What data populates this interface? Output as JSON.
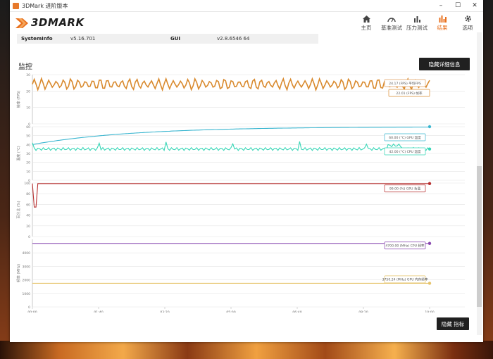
{
  "window": {
    "title": "3DMark 进阶版本",
    "controls": [
      "–",
      "☐",
      "✕"
    ]
  },
  "logo": {
    "text": "3DMARK"
  },
  "nav": [
    {
      "label": "主页",
      "icon": "home-icon"
    },
    {
      "label": "基准测试",
      "icon": "gauge-icon"
    },
    {
      "label": "压力测试",
      "icon": "stress-bars-icon"
    },
    {
      "label": "结果",
      "icon": "results-bars-icon",
      "active": true
    },
    {
      "label": "选项",
      "icon": "gear-icon"
    }
  ],
  "info": {
    "systeminfo_label": "SystemInfo",
    "systeminfo_value": "v5.16.701",
    "gui_label": "GUI",
    "gui_value": "v2.8.6546 64"
  },
  "section": {
    "title": "监控"
  },
  "buttons": {
    "hide_details": "隐藏详细信息",
    "hide_markers": "隐藏 指标"
  },
  "colors": {
    "accent": "#e8701e",
    "frame_rate": "#d98a2e",
    "avg_fps": "#e0a060",
    "cpu_temp": "#36d6b6",
    "gpu_temp": "#3ab6d0",
    "gpu_load": "#b83030",
    "cpu_clock": "#8a4ab0",
    "gpu_mem_clock": "#e6c36a"
  },
  "chart_data": {
    "type": "line",
    "x_ticks": [
      "00:00",
      "01:40",
      "03:20",
      "05:00",
      "06:40",
      "08:20",
      "10:00"
    ],
    "panels": [
      {
        "ylabel": "帧率 (FPS)",
        "ylim": [
          0,
          30
        ],
        "y_ticks": [
          "30",
          "20",
          "10",
          "0"
        ],
        "annotations": [
          {
            "text": "24.17 (FPS) 平均FPS",
            "series": "avg_fps"
          },
          {
            "text": "22.01 (FPS) 帧率",
            "series": "frame_rate"
          }
        ],
        "series": [
          {
            "key": "frame_rate",
            "name": "帧率 (FPS)",
            "mean": 24.17,
            "amplitude": 3.5
          }
        ]
      },
      {
        "ylabel": "温度 (°C)",
        "ylim": [
          0,
          60
        ],
        "y_ticks": [
          "60",
          "50",
          "40",
          "30",
          "20",
          "10",
          "0"
        ],
        "annotations": [
          {
            "text": "60.00 (°C) GPU 温度",
            "series": "gpu_temp"
          },
          {
            "text": "42.00 (°C) CPU 温度",
            "series": "cpu_temp"
          }
        ],
        "series": [
          {
            "key": "gpu_temp",
            "name": "GPU 温度 (°C)",
            "start": 40,
            "end": 60
          },
          {
            "key": "cpu_temp",
            "name": "CPU 温度 (°C)",
            "mean": 35
          }
        ]
      },
      {
        "ylabel": "百分比 (%)",
        "ylim": [
          0,
          100
        ],
        "y_ticks": [
          "100",
          "80",
          "60",
          "40",
          "20",
          "0"
        ],
        "annotations": [
          {
            "text": "99.00 (%) GPU 负载",
            "series": "gpu_load"
          }
        ],
        "series": [
          {
            "key": "gpu_load",
            "name": "GPU 负载 (%)",
            "value": 99,
            "dip_to": 55
          }
        ]
      },
      {
        "ylabel": "频率 (MHz)",
        "ylim": [
          0,
          5000
        ],
        "y_ticks": [
          "4000",
          "3000",
          "2000",
          "1000",
          "0"
        ],
        "annotations": [
          {
            "text": "4700.00 (MHz) CPU 频率",
            "series": "cpu_clock"
          },
          {
            "text": "3750.24 (MHz) GPU 内存频率",
            "series": "gpu_mem_clock"
          }
        ],
        "series": [
          {
            "key": "cpu_clock",
            "name": "CPU 频率 (MHz)",
            "value": 4700
          },
          {
            "key": "gpu_mem_clock",
            "name": "GPU 内存频率 (MHz)",
            "value": 1750
          }
        ]
      }
    ],
    "legend": [
      {
        "label": "帧率 (FPS)",
        "key": "frame_rate"
      },
      {
        "label": "平均FPS (FPS)",
        "key": "avg_fps"
      },
      {
        "label": "CPU 温度 (°C)",
        "key": "cpu_temp"
      },
      {
        "label": "GPU 温度 (°C)",
        "key": "gpu_temp"
      },
      {
        "label": "GPU 负载 (%)",
        "key": "gpu_load"
      },
      {
        "label": "CPU 频率 (MHz)",
        "key": "cpu_clock"
      },
      {
        "label": "GPU 内存频率 (MHz)",
        "key": "gpu_mem_clock"
      }
    ]
  }
}
